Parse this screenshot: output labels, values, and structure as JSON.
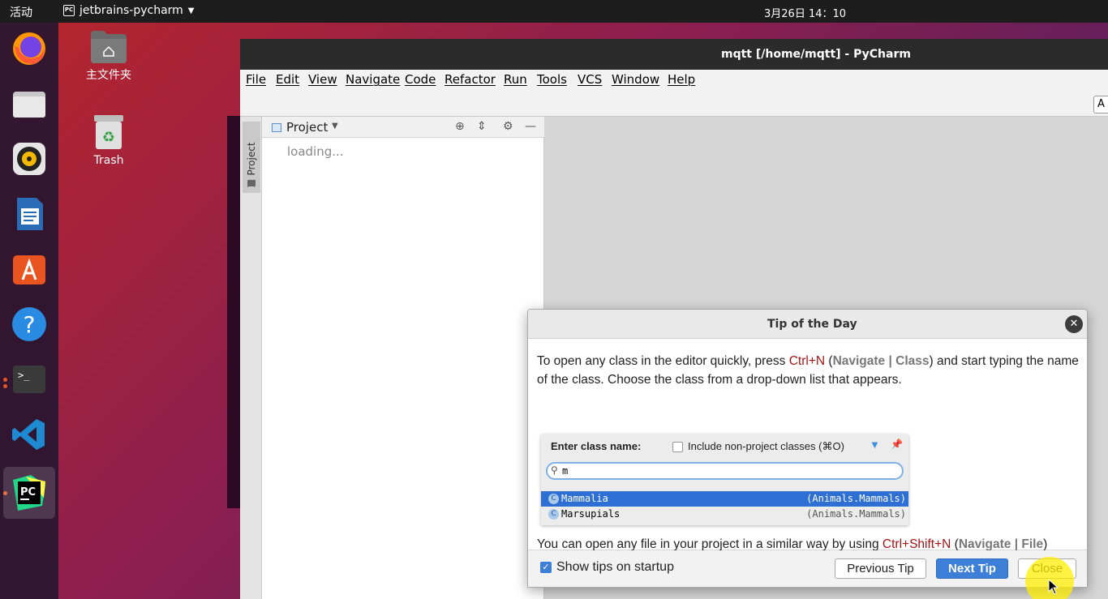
{
  "topbar": {
    "activities": "活动",
    "app_name": "jetbrains-pycharm",
    "clock": "3月26日 14：10"
  },
  "desktop": {
    "home_folder": "主文件夹",
    "trash": "Trash"
  },
  "dock": {
    "items": [
      "firefox-icon",
      "files-icon",
      "rhythmbox-icon",
      "writer-icon",
      "software-icon",
      "help-icon",
      "terminal-icon",
      "vscode-icon",
      "pycharm-icon"
    ]
  },
  "pycharm": {
    "title": "mqtt [/home/mqtt] - PyCharm",
    "menu": [
      "File",
      "Edit",
      "View",
      "Navigate",
      "Code",
      "Refactor",
      "Run",
      "Tools",
      "VCS",
      "Window",
      "Help"
    ],
    "toolbar_fragment": "A",
    "side_tab": "1: Project",
    "project_header": "Project",
    "project_status": "loading..."
  },
  "dialog": {
    "title": "Tip of the Day",
    "para1_a": "To open any class in the editor quickly, press ",
    "para1_key": "Ctrl+N",
    "para1_b": " (",
    "para1_nav": "Navigate | Class",
    "para1_c": ") and start typing the name of the class. Choose the class from a drop-down list that appears.",
    "image": {
      "label": "Enter class name:",
      "checkbox_label": "Include non-project classes (⌘O)",
      "query": "m",
      "results": [
        {
          "name": "Mammalia",
          "package": "(Animals.Mammals)",
          "selected": true
        },
        {
          "name": "Marsupials",
          "package": "(Animals.Mammals)",
          "selected": false
        }
      ]
    },
    "para2_a": "You can open any file in your project in a similar way by using ",
    "para2_key": "Ctrl+Shift+N",
    "para2_b": " (",
    "para2_nav": "Navigate | File",
    "para2_c": ")",
    "show_tips_label": "Show tips on startup",
    "show_tips_checked": true,
    "prev_button": "Previous Tip",
    "next_button": "Next Tip",
    "close_button": "Close"
  },
  "colors": {
    "accent": "#3d7fd7",
    "shortcut": "#a31515",
    "ubuntu_orange": "#e95420"
  }
}
